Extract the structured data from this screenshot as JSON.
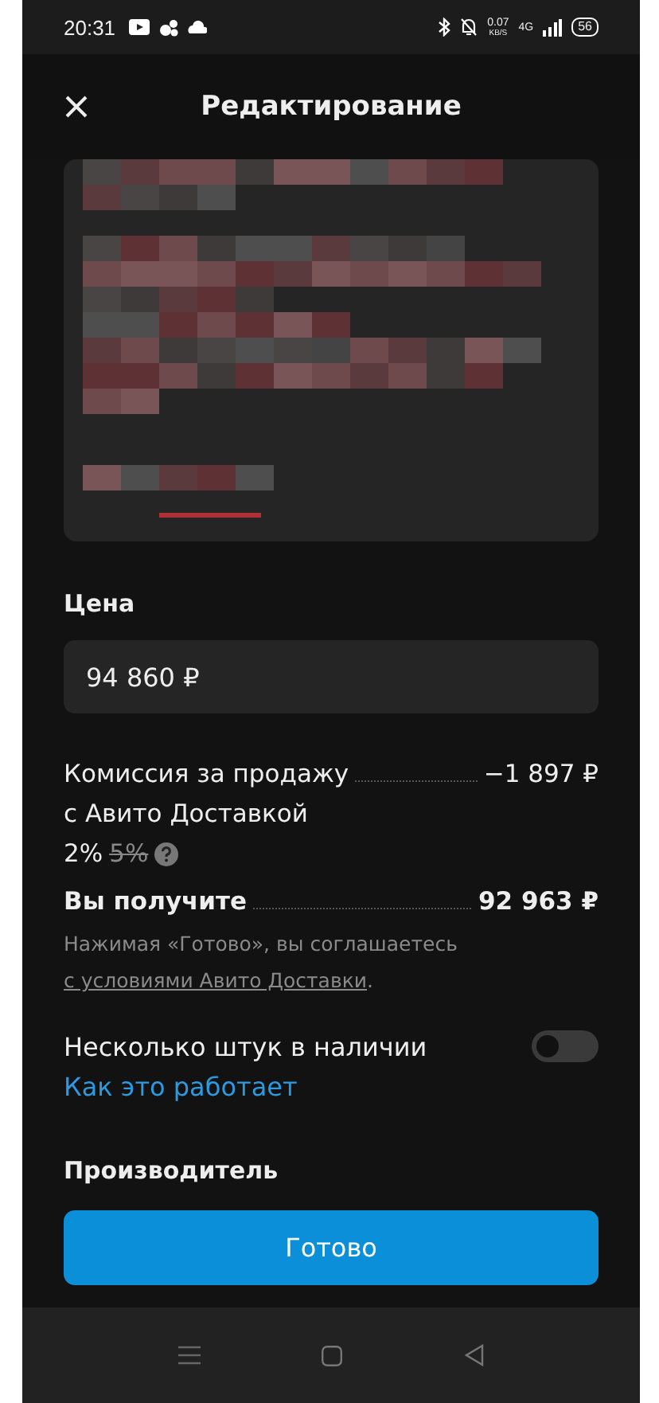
{
  "status_bar": {
    "time": "20:31",
    "speed": "0.07",
    "speed_unit": "KB/S",
    "network": "4G",
    "battery": "56"
  },
  "header": {
    "title": "Редактирование"
  },
  "price": {
    "label": "Цена",
    "value": "94 860 ₽"
  },
  "commission": {
    "label": "Комиссия за продажу",
    "label_2": "с Авито Доставкой",
    "amount": "−1 897 ₽",
    "rate": "2%",
    "old_rate": "5%"
  },
  "payout": {
    "label": "Вы получите",
    "amount": "92 963 ₽"
  },
  "note": {
    "text": "Нажимая «Готово», вы соглашаетесь",
    "link": "с условиями Авито Доставки",
    "tail": "."
  },
  "multiple": {
    "label": "Несколько штук в наличии",
    "on": false,
    "link": "Как это работает"
  },
  "next_section": {
    "label": "Производитель"
  },
  "done_button": {
    "label": "Готово"
  }
}
